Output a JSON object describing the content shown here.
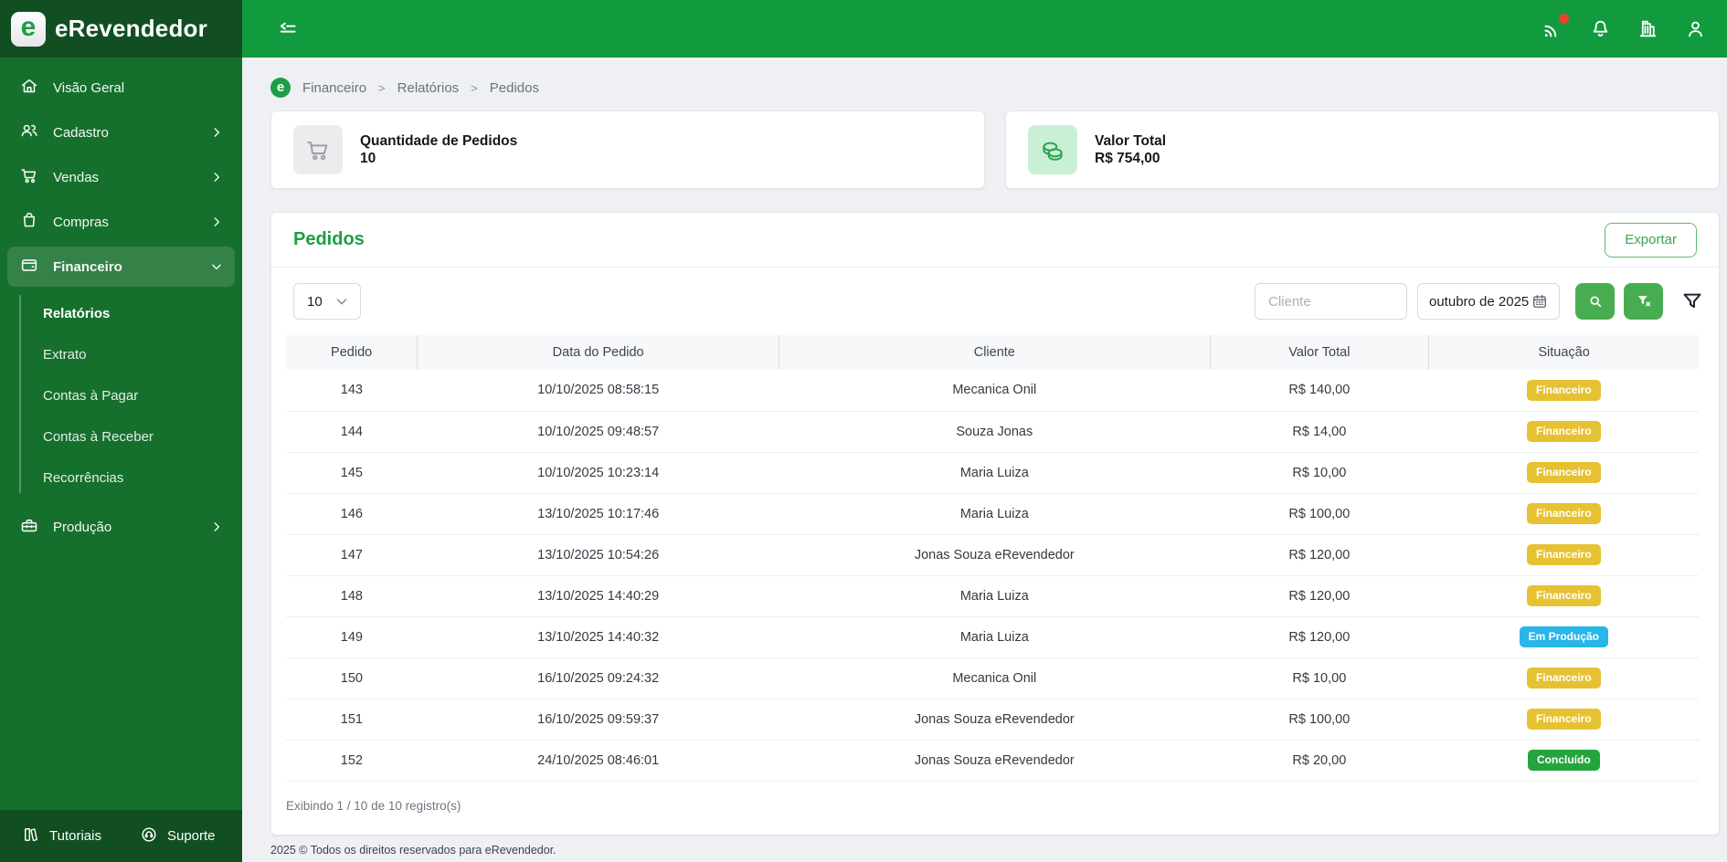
{
  "brand": {
    "name": "eRevendedor",
    "logo_letter": "e"
  },
  "topbar": {
    "icons": [
      "collapse-menu",
      "signal",
      "bell",
      "building",
      "user"
    ],
    "signal_has_notification": true
  },
  "sidebar": {
    "items": [
      {
        "label": "Visão Geral",
        "icon": "home"
      },
      {
        "label": "Cadastro",
        "icon": "users",
        "chevron": "right"
      },
      {
        "label": "Vendas",
        "icon": "cart",
        "chevron": "right"
      },
      {
        "label": "Compras",
        "icon": "bag",
        "chevron": "right"
      },
      {
        "label": "Financeiro",
        "icon": "wallet",
        "chevron": "down",
        "active": true
      },
      {
        "label": "Produção",
        "icon": "toolbox",
        "chevron": "right"
      }
    ],
    "financeiro_submenu": [
      {
        "label": "Relatórios",
        "active": true
      },
      {
        "label": "Extrato"
      },
      {
        "label": "Contas à Pagar"
      },
      {
        "label": "Contas à Receber"
      },
      {
        "label": "Recorrências"
      }
    ],
    "footer_items": [
      {
        "label": "Tutoriais",
        "icon": "books"
      },
      {
        "label": "Suporte",
        "icon": "support"
      }
    ]
  },
  "breadcrumb": {
    "items": [
      "Financeiro",
      "Relatórios",
      "Pedidos"
    ],
    "separator": ">"
  },
  "summary_cards": [
    {
      "title": "Quantidade de Pedidos",
      "value": "10",
      "icon": "cart"
    },
    {
      "title": "Valor Total",
      "value": "R$ 754,00",
      "icon": "coins"
    }
  ],
  "panel": {
    "title": "Pedidos",
    "export_button": "Exportar",
    "filters": {
      "page_size": "10",
      "client_placeholder": "Cliente",
      "period_value": "outubro de 2025"
    },
    "table": {
      "columns": [
        "Pedido",
        "Data do Pedido",
        "Cliente",
        "Valor Total",
        "Situação"
      ],
      "rows": [
        {
          "pedido": "143",
          "data": "10/10/2025 08:58:15",
          "cliente": "Mecanica Onil",
          "valor": "R$ 140,00",
          "situacao": "Financeiro",
          "situacao_tipo": "yellow"
        },
        {
          "pedido": "144",
          "data": "10/10/2025 09:48:57",
          "cliente": "Souza Jonas",
          "valor": "R$ 14,00",
          "situacao": "Financeiro",
          "situacao_tipo": "yellow"
        },
        {
          "pedido": "145",
          "data": "10/10/2025 10:23:14",
          "cliente": "Maria Luiza",
          "valor": "R$ 10,00",
          "situacao": "Financeiro",
          "situacao_tipo": "yellow"
        },
        {
          "pedido": "146",
          "data": "13/10/2025 10:17:46",
          "cliente": "Maria Luiza",
          "valor": "R$ 100,00",
          "situacao": "Financeiro",
          "situacao_tipo": "yellow"
        },
        {
          "pedido": "147",
          "data": "13/10/2025 10:54:26",
          "cliente": "Jonas Souza eRevendedor",
          "valor": "R$ 120,00",
          "situacao": "Financeiro",
          "situacao_tipo": "yellow"
        },
        {
          "pedido": "148",
          "data": "13/10/2025 14:40:29",
          "cliente": "Maria Luiza",
          "valor": "R$ 120,00",
          "situacao": "Financeiro",
          "situacao_tipo": "yellow"
        },
        {
          "pedido": "149",
          "data": "13/10/2025 14:40:32",
          "cliente": "Maria Luiza",
          "valor": "R$ 120,00",
          "situacao": "Em Produção",
          "situacao_tipo": "blue"
        },
        {
          "pedido": "150",
          "data": "16/10/2025 09:24:32",
          "cliente": "Mecanica Onil",
          "valor": "R$ 10,00",
          "situacao": "Financeiro",
          "situacao_tipo": "yellow"
        },
        {
          "pedido": "151",
          "data": "16/10/2025 09:59:37",
          "cliente": "Jonas Souza eRevendedor",
          "valor": "R$ 100,00",
          "situacao": "Financeiro",
          "situacao_tipo": "yellow"
        },
        {
          "pedido": "152",
          "data": "24/10/2025 08:46:01",
          "cliente": "Jonas Souza eRevendedor",
          "valor": "R$ 20,00",
          "situacao": "Concluído",
          "situacao_tipo": "green"
        }
      ]
    },
    "records_text": "Exibindo 1 / 10 de 10 registro(s)"
  },
  "page_footer": "2025 © Todos os direitos reservados para eRevendedor.",
  "colors": {
    "topbar": "#129a3e",
    "sidebar": "#16702d",
    "sidebar_dark": "#114f23",
    "title_green": "#1d9e46",
    "button_green": "#48ad50",
    "badge_yellow": "#e6c233",
    "badge_blue": "#29b6e8",
    "badge_green": "#23a53e",
    "notification_red": "#e8432d"
  }
}
